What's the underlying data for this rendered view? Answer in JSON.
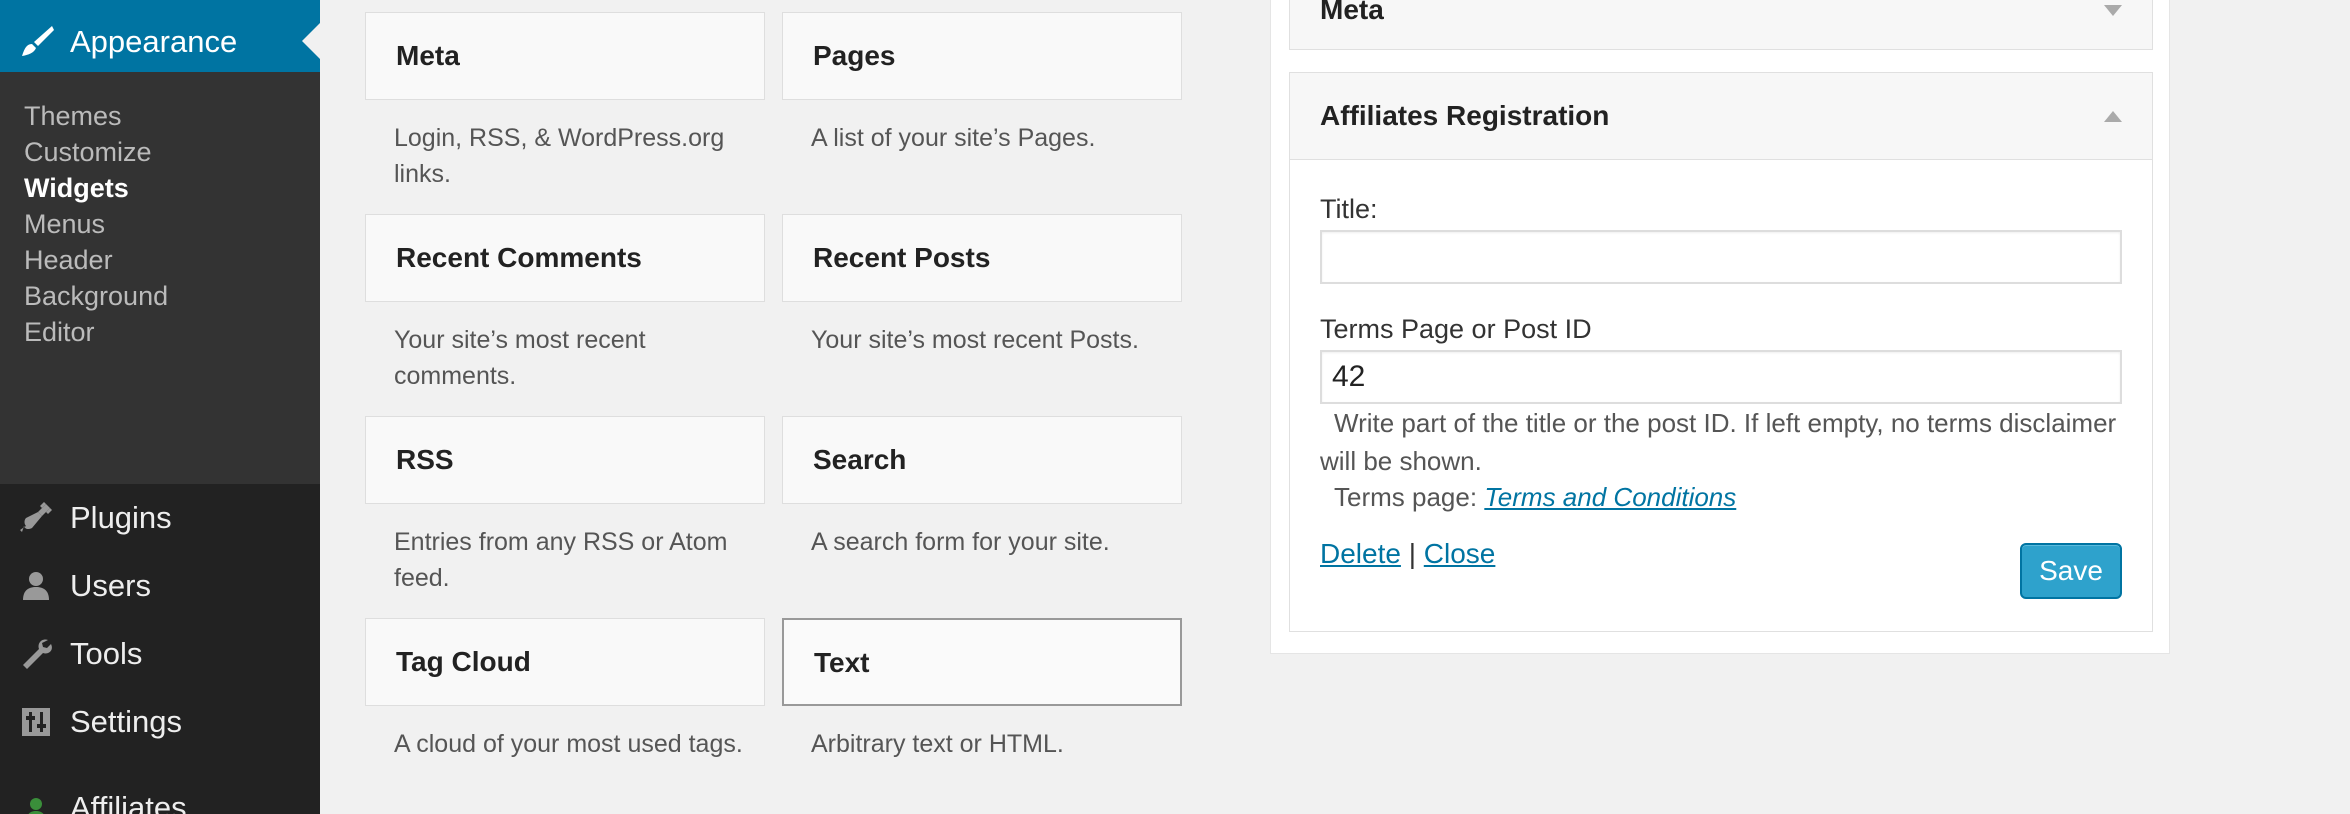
{
  "sidebar": {
    "active": {
      "label": "Appearance",
      "icon": "paintbrush-icon"
    },
    "submenu": [
      "Themes",
      "Customize",
      "Widgets",
      "Menus",
      "Header",
      "Background",
      "Editor"
    ],
    "current_submenu": "Widgets",
    "menu": [
      {
        "label": "Plugins",
        "icon": "plugin-icon"
      },
      {
        "label": "Users",
        "icon": "user-icon"
      },
      {
        "label": "Tools",
        "icon": "wrench-icon"
      },
      {
        "label": "Settings",
        "icon": "settings-sliders-icon"
      },
      {
        "label": "Affiliates",
        "icon": "affiliates-icon"
      }
    ],
    "colors": {
      "background": "#222222",
      "submenu": "#333333",
      "accent": "#0074a2"
    }
  },
  "available_widgets": [
    {
      "title": "Meta",
      "description": "Login, RSS, & WordPress.org links."
    },
    {
      "title": "Pages",
      "description": "A list of your site’s Pages."
    },
    {
      "title": "Recent Comments",
      "description": "Your site’s most recent comments."
    },
    {
      "title": "Recent Posts",
      "description": "Your site’s most recent Posts."
    },
    {
      "title": "RSS",
      "description": "Entries from any RSS or Atom feed."
    },
    {
      "title": "Search",
      "description": "A search form for your site."
    },
    {
      "title": "Tag Cloud",
      "description": "A cloud of your most used tags."
    },
    {
      "title": "Text",
      "description": "Arbitrary text or HTML."
    }
  ],
  "widget_area": {
    "collapsed_widget": {
      "title": "Meta"
    },
    "open_widget": {
      "title": "Affiliates Registration",
      "title_field": {
        "label": "Title:",
        "value": ""
      },
      "terms_field": {
        "label": "Terms Page or Post ID",
        "value": "42"
      },
      "hint": "Write part of the title or the post ID. If left empty, no terms disclaimer will be shown.",
      "terms_page_label": "Terms page:",
      "terms_page_link": "Terms and Conditions",
      "delete_label": "Delete",
      "separator": "|",
      "close_label": "Close",
      "save_label": "Save"
    }
  }
}
